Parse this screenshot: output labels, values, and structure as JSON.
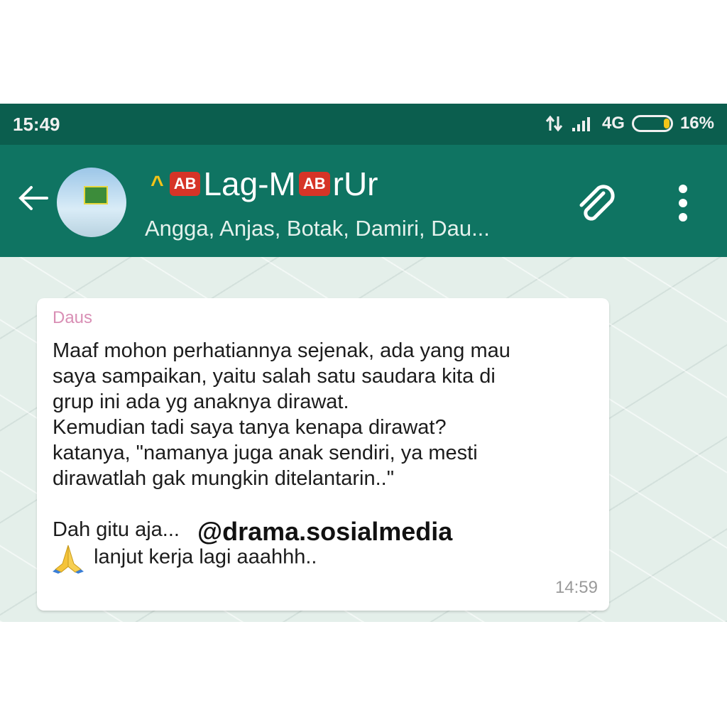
{
  "status_bar": {
    "time": "15:49",
    "network": "4G",
    "battery": "16%",
    "battery_level": 0.16
  },
  "header": {
    "group_name_part1": "Lag-M",
    "group_name_part2": "rUr",
    "badge_label": "AB",
    "members": "Angga, Anjas, Botak, Damiri, Dau..."
  },
  "message": {
    "sender": "Daus",
    "lines": [
      "Maaf mohon perhatiannya sejenak, ada yang mau",
      "saya sampaikan,  yaitu salah satu saudara kita di",
      "grup ini ada yg anaknya dirawat.",
      "Kemudian tadi saya tanya kenapa dirawat?",
      "katanya, \"namanya juga anak sendiri, ya mesti",
      "dirawatlah gak mungkin  ditelantarin..\""
    ],
    "closing_line": "Dah gitu aja...",
    "final_line": "lanjut kerja lagi aaahhh..",
    "time": "14:59"
  },
  "watermark": "@drama.sosialmedia",
  "colors": {
    "status_bar": "#0b5e4e",
    "app_bar": "#0f7462",
    "badge": "#d63427",
    "sender_name": "#d98fb5"
  },
  "icons": [
    "back-arrow-icon",
    "paperclip-icon",
    "more-vert-icon",
    "pray-hands-icon",
    "data-arrows-icon",
    "signal-icon",
    "battery-icon"
  ]
}
